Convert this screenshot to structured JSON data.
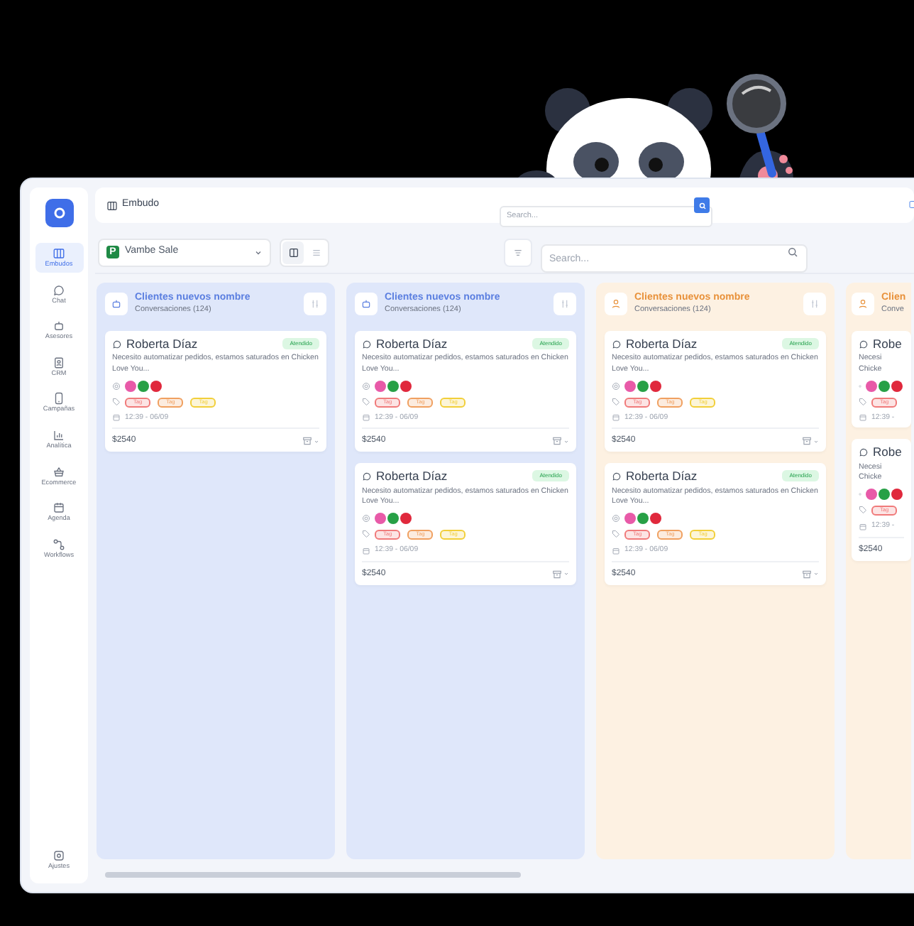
{
  "sidebar": {
    "items": [
      {
        "label": "Embudos",
        "selected": true
      },
      {
        "label": "Chat",
        "selected": false
      },
      {
        "label": "Asesores",
        "selected": false
      },
      {
        "label": "CRM",
        "selected": false
      },
      {
        "label": "Campañas",
        "selected": false
      },
      {
        "label": "Analítica",
        "selected": false
      },
      {
        "label": "Ecommerce",
        "selected": false
      },
      {
        "label": "Agenda",
        "selected": false
      },
      {
        "label": "Workflows",
        "selected": false
      }
    ],
    "footer": {
      "label": "Ajustes"
    }
  },
  "topbar": {
    "title": "Embudo",
    "search": {
      "placeholder": "Search..."
    }
  },
  "toolbar": {
    "pipeline_badge": "P",
    "pipeline": "Vambe Sale",
    "views": [
      {
        "kind": "board",
        "selected": true
      },
      {
        "kind": "list",
        "selected": false
      }
    ],
    "search": {
      "placeholder": "Search..."
    }
  },
  "columns": [
    {
      "kind": "bot",
      "color": "#5b7fe0",
      "title": "Clientes nuevos nombre",
      "subtitle": "Conversaciones (124)",
      "cards": [
        {
          "name": "Roberta Díaz",
          "status": "Atendido",
          "message": "Necesito automatizar pedidos, estamos saturados en Chicken Love You...",
          "avatars": [
            {
              "color": "#e85aa8"
            },
            {
              "color": "#27a046"
            },
            {
              "color": "#e0283c"
            }
          ],
          "tags": [
            {
              "label": "Tag",
              "color": "#f07a7a"
            },
            {
              "label": "Tag",
              "color": "#f0a060"
            },
            {
              "label": "Tag",
              "color": "#f2cf3a"
            }
          ],
          "date": "12:39 - 06/09",
          "amount": "$2540"
        }
      ]
    },
    {
      "kind": "bot",
      "color": "#5b7fe0",
      "title": "Clientes nuevos nombre",
      "subtitle": "Conversaciones (124)",
      "cards": [
        {
          "name": "Roberta Díaz",
          "status": "Atendido",
          "message": "Necesito automatizar pedidos, estamos saturados en Chicken Love You...",
          "avatars": [
            {
              "color": "#e85aa8"
            },
            {
              "color": "#27a046"
            },
            {
              "color": "#e0283c"
            }
          ],
          "tags": [
            {
              "label": "Tag",
              "color": "#f07a7a"
            },
            {
              "label": "Tag",
              "color": "#f0a060"
            },
            {
              "label": "Tag",
              "color": "#f2cf3a"
            }
          ],
          "date": "12:39 - 06/09",
          "amount": "$2540"
        },
        {
          "name": "Roberta Díaz",
          "status": "Atendido",
          "message": "Necesito automatizar pedidos, estamos saturados en Chicken Love You...",
          "avatars": [
            {
              "color": "#e85aa8"
            },
            {
              "color": "#27a046"
            },
            {
              "color": "#e0283c"
            }
          ],
          "tags": [
            {
              "label": "Tag",
              "color": "#f07a7a"
            },
            {
              "label": "Tag",
              "color": "#f0a060"
            },
            {
              "label": "Tag",
              "color": "#f2cf3a"
            }
          ],
          "date": "12:39 - 06/09",
          "amount": "$2540"
        }
      ]
    },
    {
      "kind": "person",
      "color": "#e8913a",
      "title": "Clientes nuevos nombre",
      "subtitle": "Conversaciones (124)",
      "cards": [
        {
          "name": "Roberta Díaz",
          "status": "Atendido",
          "message": "Necesito automatizar pedidos, estamos saturados en Chicken Love You...",
          "avatars": [
            {
              "color": "#e85aa8"
            },
            {
              "color": "#27a046"
            },
            {
              "color": "#e0283c"
            }
          ],
          "tags": [
            {
              "label": "Tag",
              "color": "#f07a7a"
            },
            {
              "label": "Tag",
              "color": "#f0a060"
            },
            {
              "label": "Tag",
              "color": "#f2cf3a"
            }
          ],
          "date": "12:39 - 06/09",
          "amount": "$2540"
        },
        {
          "name": "Roberta Díaz",
          "status": "Atendido",
          "message": "Necesito automatizar pedidos, estamos saturados en Chicken Love You...",
          "avatars": [
            {
              "color": "#e85aa8"
            },
            {
              "color": "#27a046"
            },
            {
              "color": "#e0283c"
            }
          ],
          "tags": [
            {
              "label": "Tag",
              "color": "#f07a7a"
            },
            {
              "label": "Tag",
              "color": "#f0a060"
            },
            {
              "label": "Tag",
              "color": "#f2cf3a"
            }
          ],
          "date": "12:39 - 06/09",
          "amount": "$2540"
        }
      ]
    },
    {
      "kind": "person",
      "color": "#e8913a",
      "title": "Clien",
      "subtitle": "Conve",
      "cards": [
        {
          "name": "Robe",
          "message": "Necesi Chicke",
          "avatars": [
            {
              "color": "#e85aa8"
            },
            {
              "color": "#27a046"
            },
            {
              "color": "#e0283c"
            }
          ],
          "tags": [
            {
              "label": "Tag",
              "color": "#f07a7a"
            }
          ],
          "date": "12:39 -"
        },
        {
          "name": "Robe",
          "message": "Necesi Chicke",
          "avatars": [
            {
              "color": "#e85aa8"
            },
            {
              "color": "#27a046"
            },
            {
              "color": "#e0283c"
            }
          ],
          "tags": [
            {
              "label": "Tag",
              "color": "#f07a7a"
            }
          ],
          "date": "12:39 -",
          "amount": "$2540"
        }
      ]
    }
  ]
}
